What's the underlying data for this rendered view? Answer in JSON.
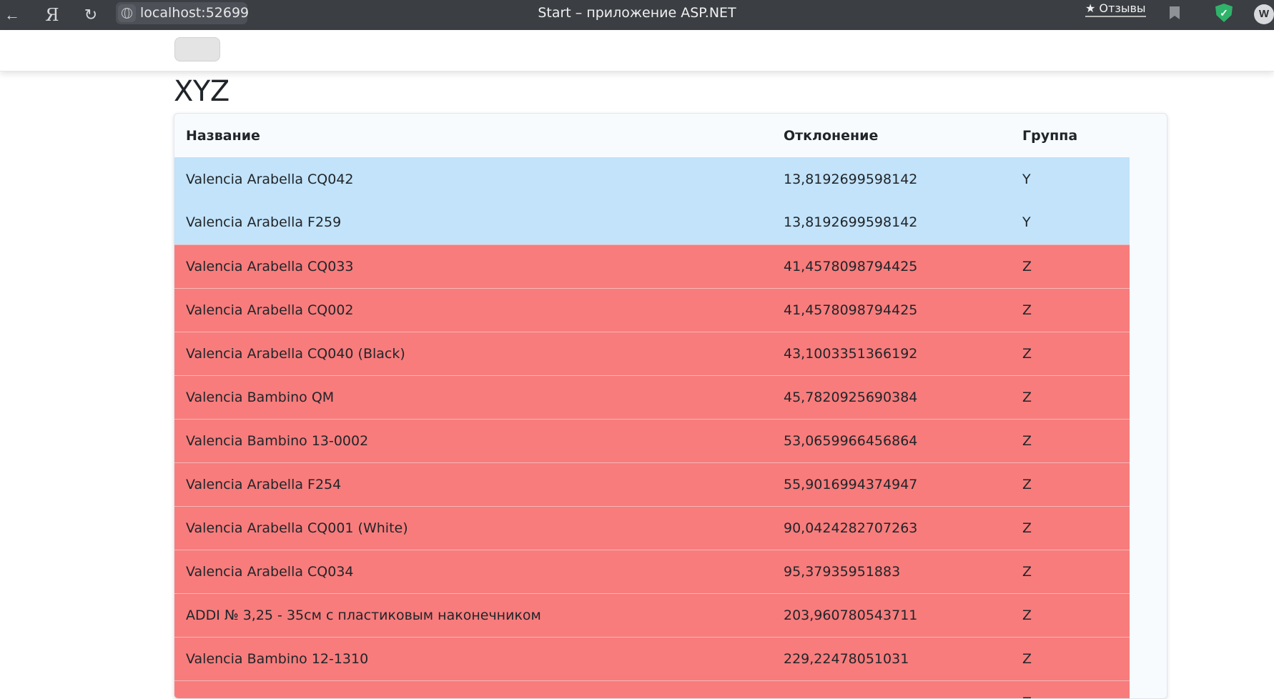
{
  "browser": {
    "url": "localhost:52699",
    "tab_title": "Start – приложение ASP.NET",
    "feedback_label": "★ Отзывы",
    "yandex_logo": "Я",
    "avatar_letter": "W"
  },
  "page": {
    "title": "XYZ"
  },
  "table": {
    "headers": [
      "Название",
      "Отклонение",
      "Группа"
    ],
    "rows": [
      {
        "name": "Valencia Arabella CQ042",
        "deviation": "13,8192699598142",
        "group": "Y"
      },
      {
        "name": "Valencia Arabella F259",
        "deviation": "13,8192699598142",
        "group": "Y"
      },
      {
        "name": "Valencia Arabella CQ033",
        "deviation": "41,4578098794425",
        "group": "Z"
      },
      {
        "name": "Valencia Arabella CQ002",
        "deviation": "41,4578098794425",
        "group": "Z"
      },
      {
        "name": "Valencia Arabella CQ040 (Black)",
        "deviation": "43,1003351366192",
        "group": "Z"
      },
      {
        "name": "Valencia Bambino QM",
        "deviation": "45,7820925690384",
        "group": "Z"
      },
      {
        "name": "Valencia Bambino 13-0002",
        "deviation": "53,0659966456864",
        "group": "Z"
      },
      {
        "name": "Valencia Arabella F254",
        "deviation": "55,9016994374947",
        "group": "Z"
      },
      {
        "name": "Valencia Arabella CQ001 (White)",
        "deviation": "90,0424282707263",
        "group": "Z"
      },
      {
        "name": "Valencia Arabella CQ034",
        "deviation": "95,37935951883",
        "group": "Z"
      },
      {
        "name": "ADDI № 3,25 - 35см с пластиковым наконечником",
        "deviation": "203,960780543711",
        "group": "Z"
      },
      {
        "name": "Valencia Bambino 12-1310",
        "deviation": "229,22478051031",
        "group": "Z"
      },
      {
        "name": "",
        "deviation": "",
        "group": "Z"
      }
    ]
  },
  "colors": {
    "group_y_row": "#c2e3fa",
    "group_z_row": "#f87c7c"
  }
}
